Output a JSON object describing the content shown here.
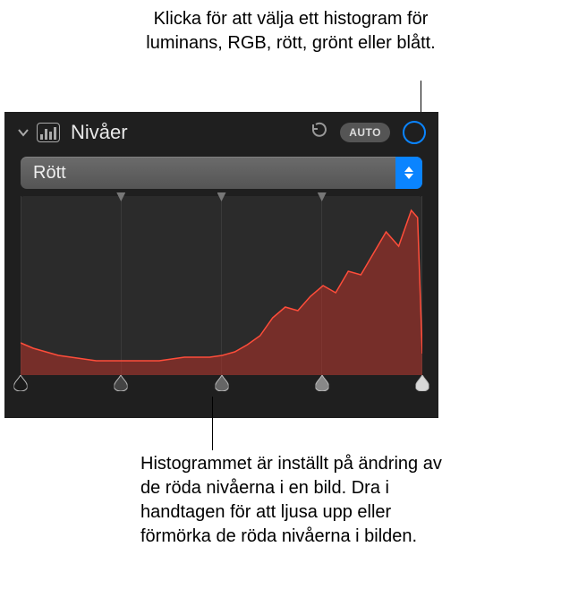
{
  "callouts": {
    "top": "Klicka för att välja ett histogram för luminans, RGB, rött, grönt eller blått.",
    "bottom": "Histogrammet är inställt på ändring av de röda nivåerna i en bild. Dra i handtagen för att ljusa upp eller förmörka de röda nivåerna i bilden."
  },
  "panel": {
    "title": "Nivåer",
    "auto_label": "AUTO",
    "dropdown_value": "Rött"
  },
  "colors": {
    "accent": "#0a84ff",
    "histogram_stroke": "#ff4d3a",
    "histogram_fill": "rgba(180,50,40,0.55)"
  },
  "chart_data": {
    "type": "area",
    "title": "Rött",
    "xlabel": "",
    "ylabel": "",
    "xlim": [
      0,
      255
    ],
    "ylim": [
      0,
      100
    ],
    "x": [
      0,
      8,
      16,
      24,
      32,
      40,
      48,
      56,
      64,
      72,
      80,
      88,
      96,
      104,
      112,
      120,
      128,
      136,
      144,
      152,
      160,
      168,
      176,
      184,
      192,
      200,
      208,
      216,
      224,
      232,
      240,
      248,
      252,
      255
    ],
    "values": [
      18,
      15,
      13,
      11,
      10,
      9,
      8,
      8,
      8,
      8,
      8,
      8,
      9,
      10,
      10,
      10,
      11,
      13,
      17,
      22,
      32,
      38,
      36,
      44,
      50,
      46,
      58,
      56,
      68,
      80,
      72,
      92,
      88,
      12
    ],
    "handles_top": [
      25,
      50,
      75
    ],
    "handles_bottom": [
      0,
      25,
      50,
      75,
      100
    ]
  }
}
